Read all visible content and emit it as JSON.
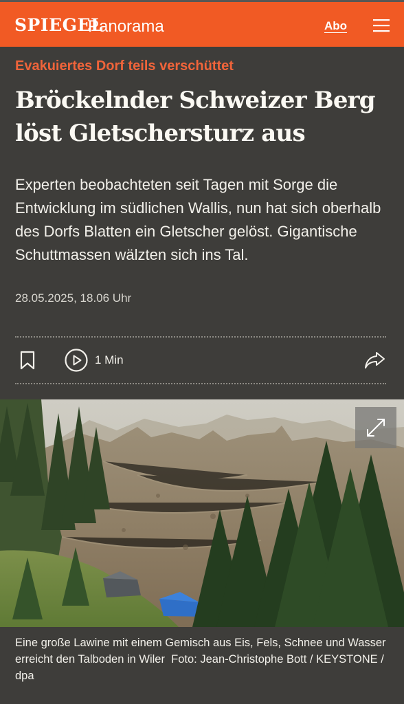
{
  "header": {
    "brand": "SPIEGEL",
    "section": "Panorama",
    "abo_label": "Abo",
    "menu_icon": "hamburger-menu-icon",
    "background_color": "#f15a24"
  },
  "article": {
    "kicker": "Evakuiertes Dorf teils verschüttet",
    "headline_line1": "Bröckelnder Schweizer Berg",
    "headline_line2": "löst Gletschersturz aus",
    "teaser": "Experten beobachteten seit Tagen mit Sorge die Entwicklung im südlichen Wallis, nun hat sich oberhalb des Dorfs Blatten ein Gletscher gelöst. Gigantische Schuttmassen wälzten sich ins Tal.",
    "date": "28.05.2025, 18.06 Uhr",
    "kicker_color": "#f0643a"
  },
  "actions": {
    "bookmark_icon": "bookmark-icon",
    "play_icon": "play-icon",
    "duration": "1 Min",
    "share_icon": "share-icon"
  },
  "image": {
    "description_icon": "expand-icon",
    "caption": "Eine große Lawine mit einem Gemisch aus Eis, Fels, Schnee und Wasser erreicht den Talboden in Wiler",
    "credit": "Foto: Jean-Christophe Bott / KEYSTONE / dpa"
  }
}
